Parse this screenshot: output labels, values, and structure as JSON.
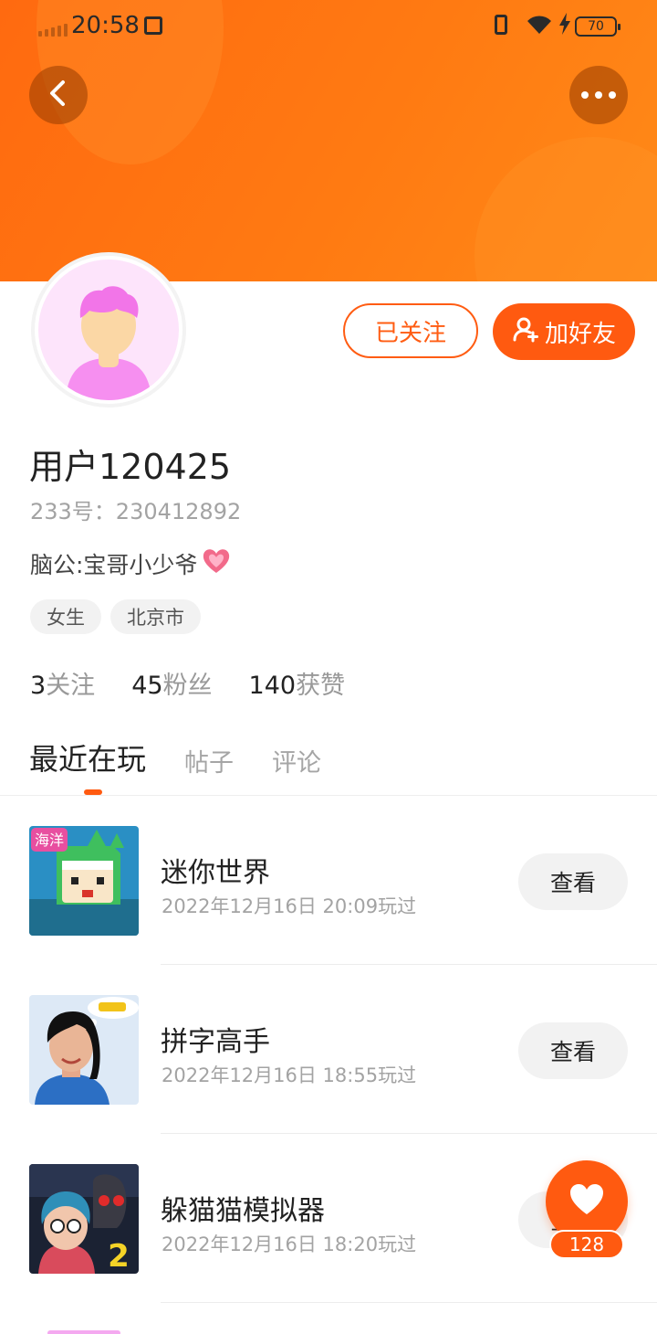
{
  "status_bar": {
    "time": "20:58",
    "battery": "70"
  },
  "profile": {
    "username": "用户120425",
    "id_line": "233号：230412892",
    "bio": "脑公:宝哥小少爷",
    "tags": [
      "女生",
      "北京市"
    ],
    "stats": [
      {
        "num": "3",
        "label": "关注"
      },
      {
        "num": "45",
        "label": "粉丝"
      },
      {
        "num": "140",
        "label": "获赞"
      }
    ]
  },
  "actions": {
    "follow_label": "已关注",
    "add_friend_label": "加好友"
  },
  "tabs": [
    {
      "label": "最近在玩",
      "active": true
    },
    {
      "label": "帖子",
      "active": false
    },
    {
      "label": "评论",
      "active": false
    }
  ],
  "games": [
    {
      "title": "迷你世界",
      "time": "2022年12月16日 20:09玩过",
      "button": "查看",
      "thumb_text": "海洋"
    },
    {
      "title": "拼字高手",
      "time": "2022年12月16日 18:55玩过",
      "button": "查看"
    },
    {
      "title": "躲猫猫模拟器",
      "time": "2022年12月16日 18:20玩过",
      "button": "查看",
      "thumb_text": "2"
    }
  ],
  "fab": {
    "like_count": "128"
  },
  "colors": {
    "accent": "#ff5a10",
    "banner_start": "#ff6a10",
    "banner_end": "#ff8a18"
  }
}
